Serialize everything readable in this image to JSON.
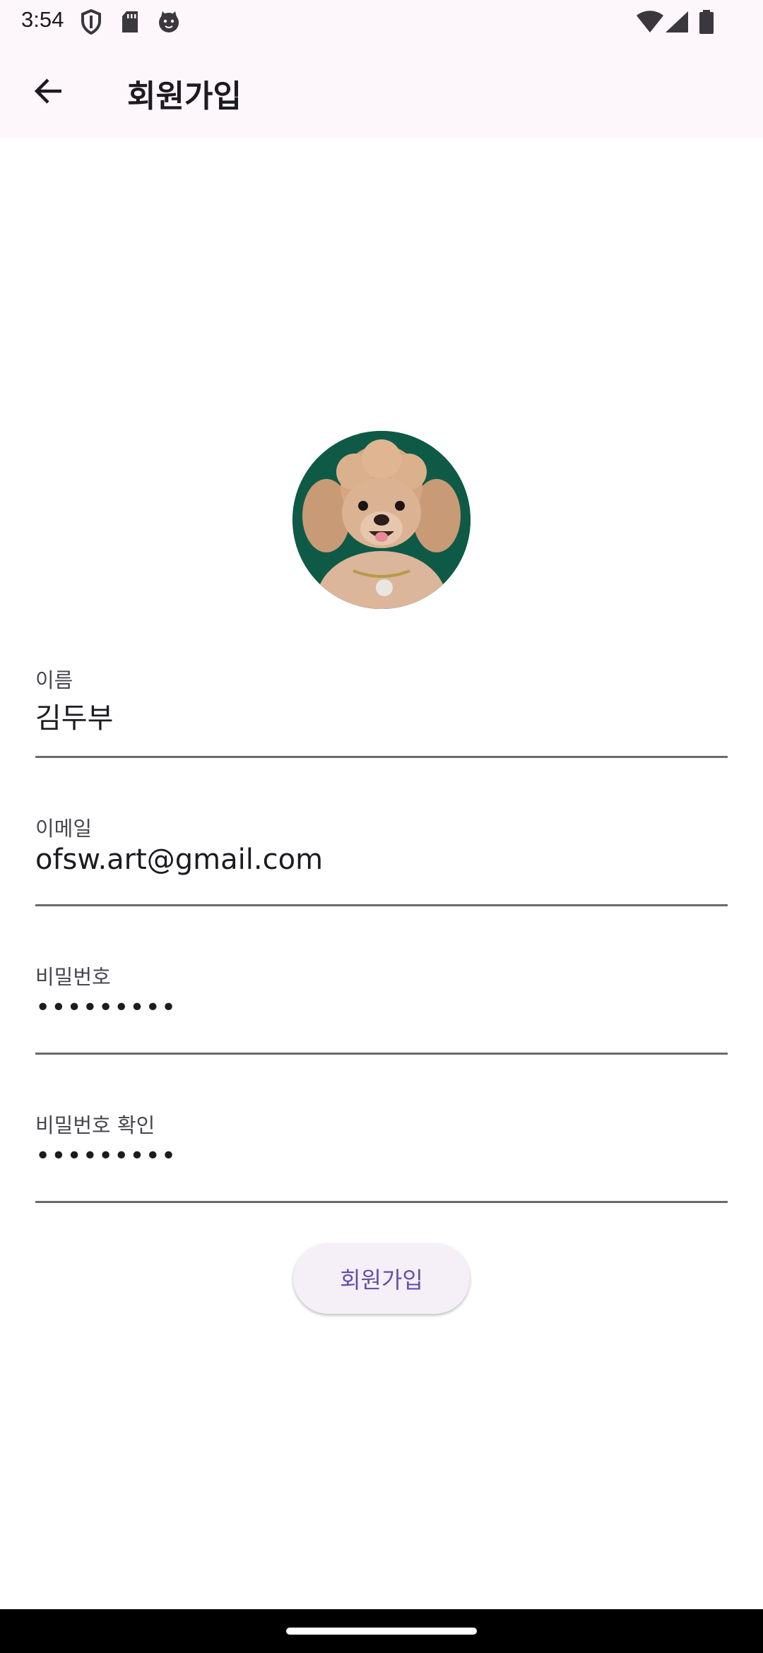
{
  "status_bar": {
    "time": "3:54",
    "left_icons": [
      "shield-icon",
      "sd-card-icon",
      "cat-face-icon"
    ],
    "right_icons": [
      "wifi-icon",
      "signal-icon",
      "battery-icon"
    ]
  },
  "app_bar": {
    "title": "회원가입",
    "back_icon": "arrow-back-icon"
  },
  "profile": {
    "avatar_icon": "dog-photo-avatar"
  },
  "form": {
    "name": {
      "label": "이름",
      "value": "김두부"
    },
    "email": {
      "label": "이메일",
      "value": "ofsw.art@gmail.com"
    },
    "password": {
      "label": "비밀번호",
      "value": "•••••••••"
    },
    "password_confirm": {
      "label": "비밀번호 확인",
      "value": "•••••••••"
    }
  },
  "actions": {
    "signup_label": "회원가입"
  },
  "colors": {
    "app_bar_bg": "#fdf7fb",
    "button_bg": "#f5eff7",
    "button_text": "#6750a4",
    "avatar_bg": "#0f5a46"
  }
}
